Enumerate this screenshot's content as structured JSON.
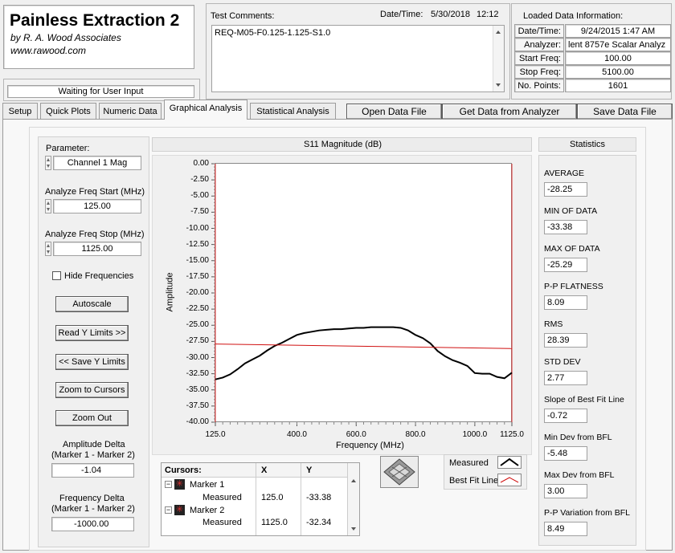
{
  "app": {
    "title": "Painless Extraction 2",
    "company": "by R. A. Wood Associates",
    "url": "www.rawood.com",
    "status": "Waiting for User Input"
  },
  "header": {
    "comments_label": "Test Comments:",
    "comments_value": "REQ-M05-F0.125-1.125-S1.0",
    "datetime_label": "Date/Time:",
    "date": "5/30/2018",
    "time": "12:12",
    "loaded_title": "Loaded Data Information:",
    "loaded_rows": [
      {
        "label": "Date/Time:",
        "value": "9/24/2015 1:47 AM"
      },
      {
        "label": "Analyzer:",
        "value": "lent 8757e Scalar Analyz"
      },
      {
        "label": "Start Freq:",
        "value": "100.00"
      },
      {
        "label": "Stop Freq:",
        "value": "5100.00"
      },
      {
        "label": "No. Points:",
        "value": "1601"
      }
    ]
  },
  "tabs": [
    "Setup",
    "Quick Plots",
    "Numeric Data",
    "Graphical Analysis",
    "Statistical Analysis"
  ],
  "actions": {
    "open": "Open Data File",
    "get": "Get Data from Analyzer",
    "save": "Save Data File"
  },
  "left": {
    "parameter_label": "Parameter:",
    "parameter_value": "Channel 1 Mag",
    "start_label": "Analyze Freq Start (MHz)",
    "start_value": "125.00",
    "stop_label": "Analyze Freq Stop (MHz)",
    "stop_value": "1125.00",
    "hide_freq": "Hide Frequencies",
    "autoscale": "Autoscale",
    "read_y": "Read Y Limits >>",
    "save_y": "<< Save Y Limits",
    "zoom_cursors": "Zoom to Cursors",
    "zoom_out": "Zoom Out",
    "amp_delta_label1": "Amplitude Delta",
    "amp_delta_label2": "(Marker 1 - Marker 2)",
    "amp_delta_value": "-1.04",
    "freq_delta_label1": "Frequency Delta",
    "freq_delta_label2": "(Marker 1 - Marker 2)",
    "freq_delta_value": "-1000.00"
  },
  "cursors": {
    "header": [
      "Cursors:",
      "X",
      "Y"
    ],
    "rows": [
      {
        "name": "Marker 1",
        "sub": "Measured",
        "x": "125.0",
        "y": "-33.38"
      },
      {
        "name": "Marker 2",
        "sub": "Measured",
        "x": "1125.0",
        "y": "-32.34"
      }
    ]
  },
  "legend": {
    "measured": "Measured",
    "bfl": "Best Fit Line"
  },
  "stats": {
    "title": "Statistics",
    "items": [
      {
        "label": "AVERAGE",
        "value": "-28.25"
      },
      {
        "label": "MIN OF DATA",
        "value": "-33.38"
      },
      {
        "label": "MAX OF DATA",
        "value": "-25.29"
      },
      {
        "label": "P-P FLATNESS",
        "value": "8.09"
      },
      {
        "label": "RMS",
        "value": "28.39"
      },
      {
        "label": "STD DEV",
        "value": "2.77"
      },
      {
        "label": "Slope of Best Fit Line",
        "value": "-0.72"
      },
      {
        "label": "Min Dev from BFL",
        "value": "-5.48"
      },
      {
        "label": "Max Dev from BFL",
        "value": "3.00"
      },
      {
        "label": "P-P Variation from BFL",
        "value": "8.49"
      }
    ]
  },
  "colors": {
    "measured": "#000000",
    "bfl": "#d01010",
    "cursor": "#e03030"
  },
  "chart_data": {
    "type": "line",
    "title": "S11 Magnitude (dB)",
    "xlabel": "Frequency (MHz)",
    "ylabel": "Amplitude",
    "xlim": [
      125,
      1125
    ],
    "ylim": [
      -40,
      0
    ],
    "xticks": [
      "125.0",
      "400.0",
      "600.0",
      "800.0",
      "1000.0",
      "1125.0"
    ],
    "yticks": [
      "0.00",
      "-2.50",
      "-5.00",
      "-7.50",
      "-10.00",
      "-12.50",
      "-15.00",
      "-17.50",
      "-20.00",
      "-22.50",
      "-25.00",
      "-27.50",
      "-30.00",
      "-32.50",
      "-35.00",
      "-37.50",
      "-40.00"
    ],
    "series": [
      {
        "name": "Measured",
        "x": [
          125,
          150,
          175,
          200,
          225,
          250,
          275,
          300,
          325,
          350,
          375,
          400,
          425,
          450,
          475,
          500,
          525,
          550,
          575,
          600,
          625,
          650,
          675,
          700,
          725,
          750,
          775,
          800,
          825,
          850,
          875,
          900,
          925,
          950,
          975,
          1000,
          1025,
          1050,
          1075,
          1100,
          1125
        ],
        "y": [
          -33.38,
          -33.1,
          -32.6,
          -31.8,
          -30.9,
          -30.3,
          -29.7,
          -28.9,
          -28.2,
          -27.7,
          -27.1,
          -26.5,
          -26.2,
          -26.0,
          -25.8,
          -25.7,
          -25.6,
          -25.6,
          -25.5,
          -25.4,
          -25.4,
          -25.3,
          -25.3,
          -25.3,
          -25.3,
          -25.4,
          -25.8,
          -26.5,
          -27.0,
          -27.8,
          -29.0,
          -29.8,
          -30.4,
          -30.8,
          -31.3,
          -32.4,
          -32.5,
          -32.5,
          -33.0,
          -33.2,
          -32.34
        ]
      },
      {
        "name": "Best Fit Line",
        "x": [
          125,
          1125
        ],
        "y": [
          -27.9,
          -28.6
        ]
      }
    ],
    "cursors": [
      125,
      1125
    ],
    "grid": false
  }
}
